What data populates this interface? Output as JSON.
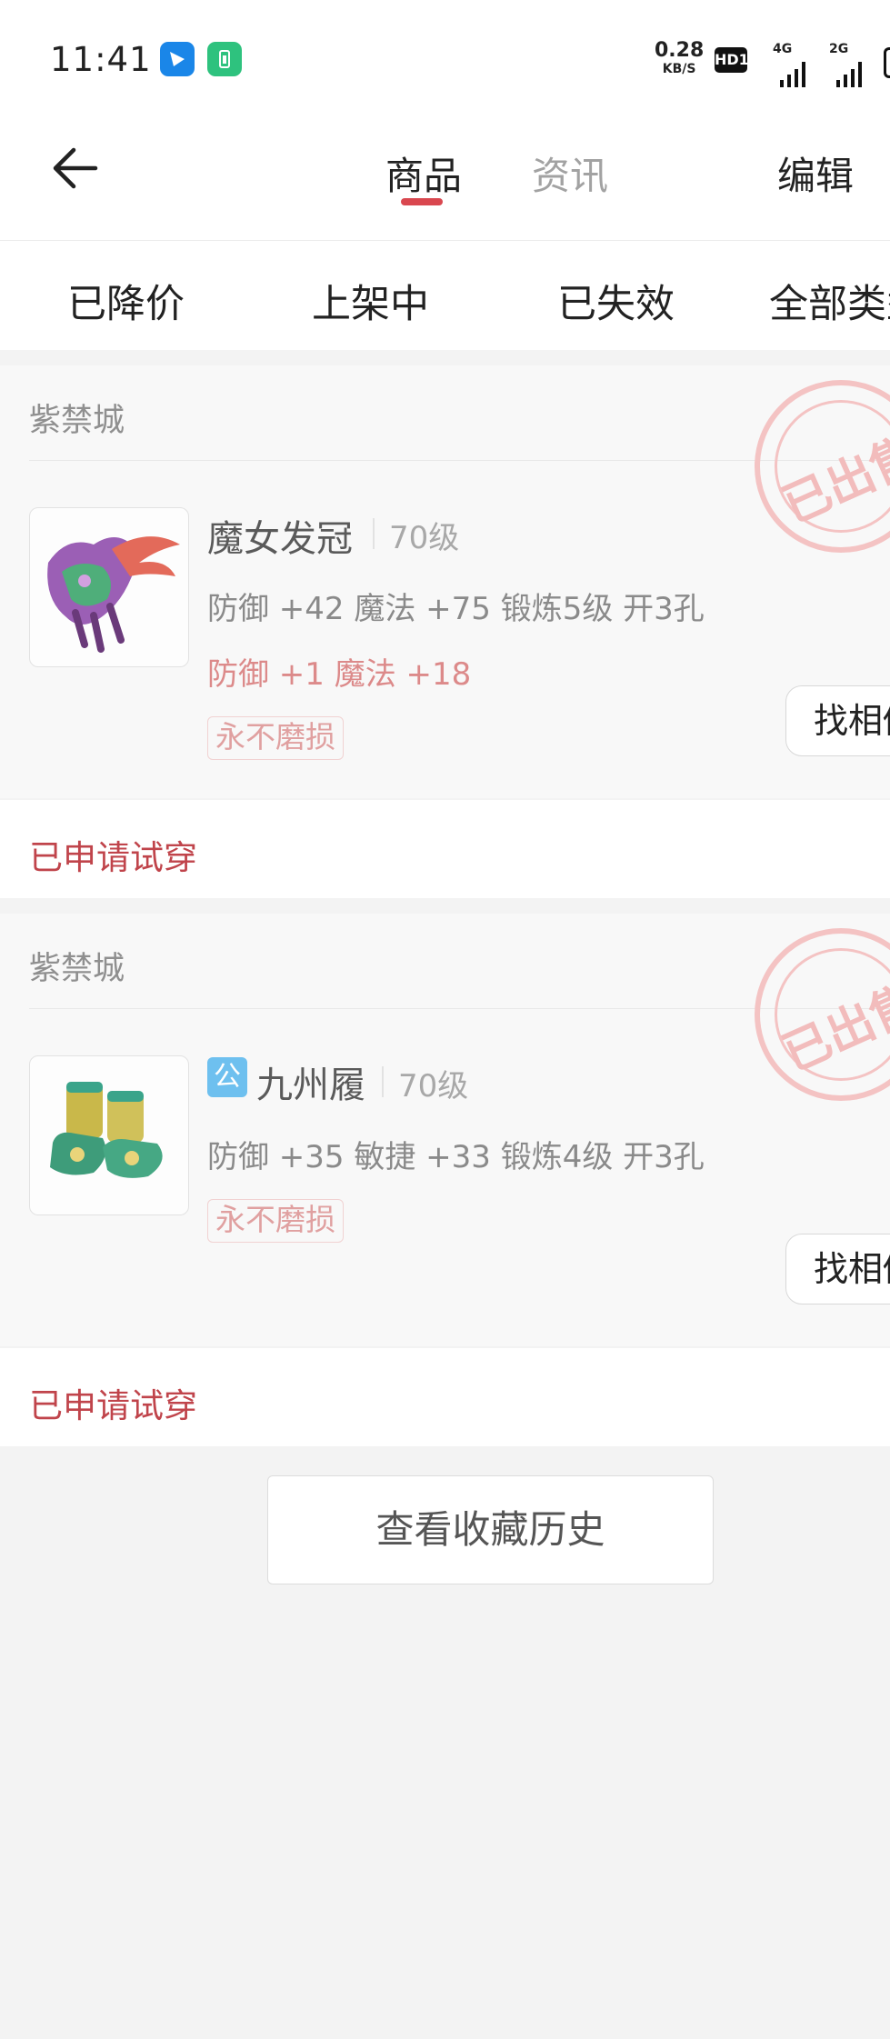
{
  "status_bar": {
    "time": "11:41",
    "net_speed_value": "0.28",
    "net_speed_unit": "KB/S",
    "hd_badge": "HD1",
    "signal_1_label": "4G",
    "signal_2_label": "2G"
  },
  "header": {
    "tabs": [
      {
        "label": "商品",
        "active": true
      },
      {
        "label": "资讯",
        "active": false
      }
    ],
    "edit_label": "编辑",
    "accent_color": "#d9474f"
  },
  "filters": [
    "已降价",
    "上架中",
    "已失效",
    "全部类型"
  ],
  "items": [
    {
      "server": "紫禁城",
      "stamp": "已出售",
      "name": "魔女发冠",
      "level": "70级",
      "stats": "防御 +42 魔法 +75 锻炼5级 开3孔",
      "bonus": "防御 +1 魔法 +18",
      "tag": "永不磨损",
      "find_button": "找相似",
      "footer": "已申请试穿",
      "icon": "witch-crown-icon"
    },
    {
      "server": "紫禁城",
      "stamp": "已出售",
      "badge": "公",
      "name": "九州履",
      "level": "70级",
      "stats": "防御 +35 敏捷 +33 锻炼4级 开3孔",
      "tag": "永不磨损",
      "find_button": "找相似",
      "footer": "已申请试穿",
      "icon": "jiuzhou-boots-icon"
    }
  ],
  "history_button": "查看收藏历史"
}
